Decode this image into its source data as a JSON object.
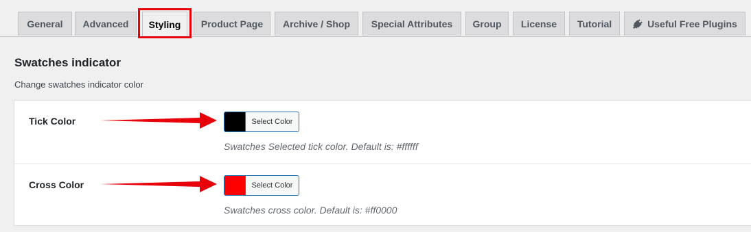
{
  "tabs": [
    {
      "label": "General"
    },
    {
      "label": "Advanced"
    },
    {
      "label": "Styling",
      "active": true
    },
    {
      "label": "Product Page"
    },
    {
      "label": "Archive / Shop"
    },
    {
      "label": "Special Attributes"
    },
    {
      "label": "Group"
    },
    {
      "label": "License"
    },
    {
      "label": "Tutorial"
    },
    {
      "label": "Useful Free Plugins",
      "icon": "plug-icon"
    }
  ],
  "section": {
    "title": "Swatches indicator",
    "description": "Change swatches indicator color"
  },
  "settings": [
    {
      "label": "Tick Color",
      "color": "#000000",
      "button_label": "Select Color",
      "description": "Swatches Selected tick color. Default is: #ffffff"
    },
    {
      "label": "Cross Color",
      "color": "#ff0000",
      "button_label": "Select Color",
      "description": "Swatches cross color. Default is: #ff0000"
    }
  ],
  "colors": {
    "annotation_red": "#e8000b",
    "accent_blue": "#2271b1"
  }
}
